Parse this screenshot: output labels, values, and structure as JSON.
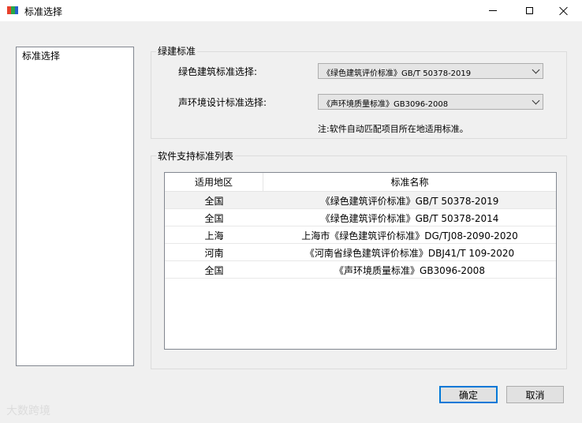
{
  "window": {
    "title": "标准选择",
    "icon": "app-logo-icon",
    "icon_colors": [
      "#e8412c",
      "#27a845",
      "#2563c9"
    ]
  },
  "sidebar": {
    "items": [
      {
        "label": "标准选择"
      }
    ]
  },
  "green_building": {
    "group_label": "绿建标准",
    "green_label": "绿色建筑标准选择:",
    "green_value": "《绿色建筑评价标准》GB/T 50378-2019",
    "acoustic_label": "声环境设计标准选择:",
    "acoustic_value": "《声环境质量标准》GB3096-2008",
    "note": "注:软件自动匹配项目所在地适用标准。"
  },
  "standards_list": {
    "group_label": "软件支持标准列表",
    "columns": [
      "适用地区",
      "标准名称"
    ],
    "rows": [
      {
        "region": "全国",
        "name": "《绿色建筑评价标准》GB/T 50378-2019",
        "selected": true
      },
      {
        "region": "全国",
        "name": "《绿色建筑评价标准》GB/T 50378-2014"
      },
      {
        "region": "上海",
        "name": "上海市《绿色建筑评价标准》DG/TJ08-2090-2020"
      },
      {
        "region": "河南",
        "name": "《河南省绿色建筑评价标准》DBJ41/T 109-2020"
      },
      {
        "region": "全国",
        "name": "《声环境质量标准》GB3096-2008"
      }
    ]
  },
  "buttons": {
    "ok": "确定",
    "cancel": "取消"
  },
  "watermark": "大数跨境",
  "accent_color": "#0078d7"
}
